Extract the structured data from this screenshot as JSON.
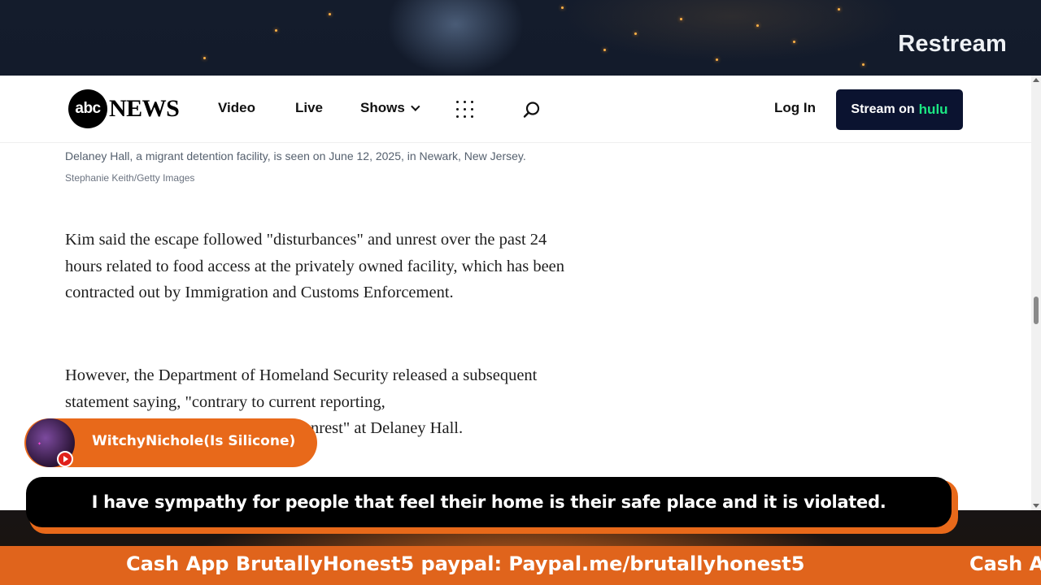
{
  "stream": {
    "brand": "Restream"
  },
  "navbar": {
    "logo_circle": "abc",
    "logo_word": "NEWS",
    "links": [
      "Video",
      "Live",
      "Shows"
    ],
    "login": "Log In",
    "hulu_prefix": "Stream on",
    "hulu_brand": "hulu"
  },
  "article": {
    "caption": "Delaney Hall, a migrant detention facility, is seen on June 12, 2025, in Newark, New Jersey.",
    "credit": "Stephanie Keith/Getty Images",
    "paragraphs": [
      "Kim said the escape followed \"disturbances\" and unrest over the past 24 hours related to food access at the privately owned facility, which has been contracted out by Immigration and Customs Enforcement.",
      "However, the Department of Homeland Security released a subsequent statement saying, \"contrary to current reporting,"
    ],
    "partial_line_end": "nrest\" at Delaney Hall."
  },
  "chat": {
    "username": "WitchyNichole(Is Silicone)",
    "message": "I have sympathy for people that feel their home is their safe place and it is violated."
  },
  "ticker": {
    "text": "Cash App BrutallyHonest5 paypal: Paypal.me/brutallyhonest5",
    "repeat_text": "Cash A"
  },
  "colors": {
    "overlay_orange": "#e8691a",
    "hulu_green": "#1ce783",
    "hulu_button": "#0b1330"
  }
}
